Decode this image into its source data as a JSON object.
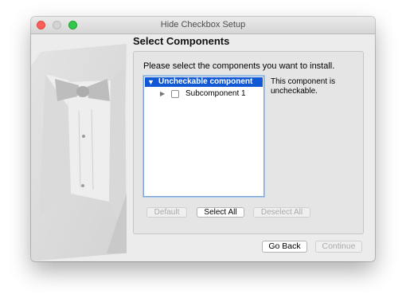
{
  "window": {
    "title": "Hide Checkbox Setup"
  },
  "page": {
    "title": "Select Components",
    "instructions": "Please select the components you want to install."
  },
  "tree": {
    "items": [
      {
        "label": "Uncheckable component",
        "selected": true,
        "expanded": true
      },
      {
        "label": "Subcomponent 1",
        "checked": false,
        "expanded": false
      }
    ]
  },
  "description": "This component is uncheckable.",
  "buttons": {
    "default": "Default",
    "select_all": "Select All",
    "deselect_all": "Deselect All",
    "go_back": "Go Back",
    "continue": "Continue"
  },
  "icons": {
    "close": "close-icon",
    "minimize": "minimize-icon",
    "zoom": "zoom-icon",
    "expanded": "triangle-down-icon",
    "collapsed": "triangle-right-icon",
    "checkbox": "checkbox-icon",
    "installer_art": "tuxedo-illustration"
  },
  "colors": {
    "selection": "#1158d4",
    "close": "#fc5f57",
    "zoom": "#34c84a"
  }
}
